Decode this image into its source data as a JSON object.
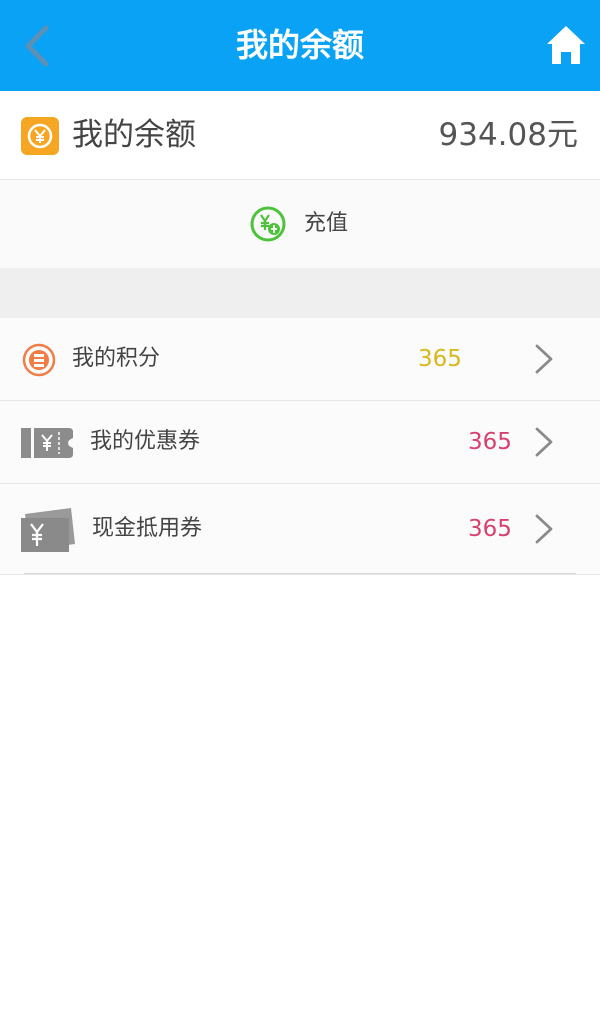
{
  "header": {
    "title": "我的余额",
    "back_icon": "chevron-left-icon",
    "home_icon": "home-icon",
    "color": "#0aa2f5"
  },
  "balance": {
    "label": "我的余额",
    "amount": "934.08元",
    "icon": "yuan-coin-icon",
    "icon_color": "#f5a623"
  },
  "recharge": {
    "label": "充值",
    "icon": "recharge-icon",
    "icon_color": "#4cc33b"
  },
  "list": [
    {
      "label": "我的积分",
      "value": "365",
      "icon": "points-icon",
      "value_color": "#d9b81e"
    },
    {
      "label": "我的优惠券",
      "value": "365",
      "icon": "coupon-icon",
      "value_color": "#d8416f"
    },
    {
      "label": "现金抵用券",
      "value": "365",
      "icon": "cash-voucher-icon",
      "value_color": "#d8416f"
    }
  ]
}
